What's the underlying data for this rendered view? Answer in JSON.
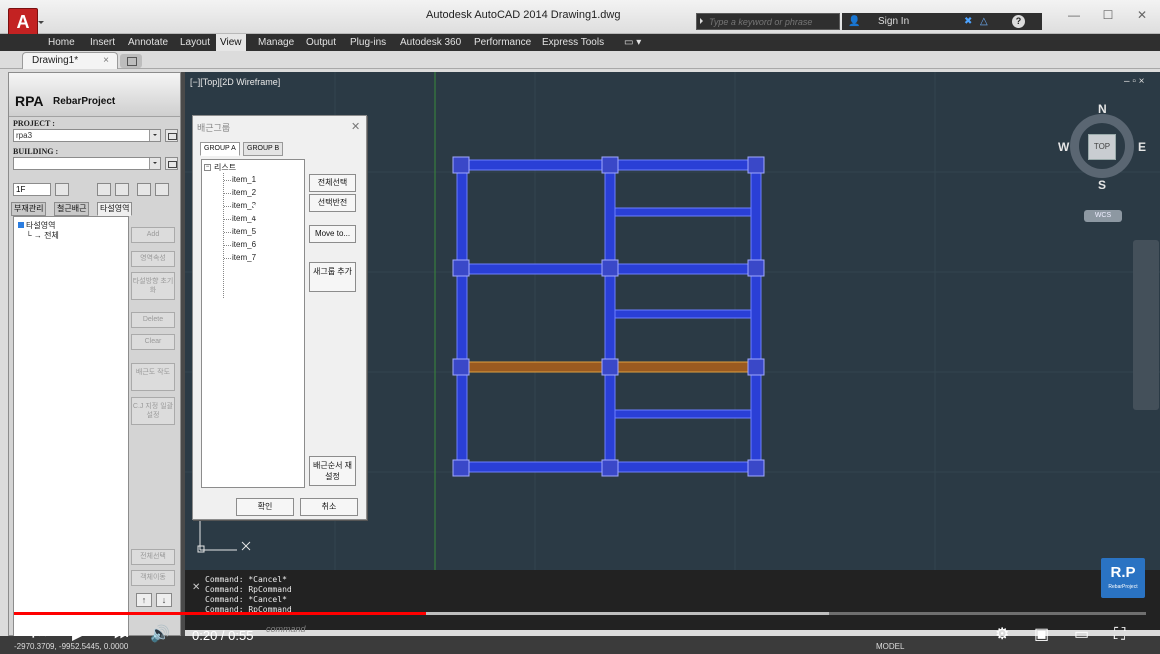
{
  "titlebar": {
    "title": "Autodesk AutoCAD 2014     Drawing1.dwg",
    "search_placeholder": "Type a keyword or phrase",
    "signin": "Sign In",
    "logo_letter": "A"
  },
  "ribbon_tabs": [
    "Home",
    "Insert",
    "Annotate",
    "Layout",
    "View",
    "Manage",
    "Output",
    "Plug-ins",
    "Autodesk 360",
    "Performance",
    "Express Tools"
  ],
  "active_ribbon_tab": "View",
  "doc_tab": "Drawing1*",
  "palette": {
    "brand": "RPA",
    "brand_sub": "RebarProject",
    "project_label": "PROJECT :",
    "project_value": "rpa3",
    "building_label": "BUILDING :",
    "building_value": "",
    "floor_value": "1F",
    "tabs": [
      "부재관리",
      "철근배근",
      "타설영역"
    ],
    "tree_root": "타설영역",
    "tree_child": "전체",
    "buttons": [
      "Add",
      "영역속성",
      "타설방향 초기화",
      "Delete",
      "Clear",
      "배근도 작도",
      "C.J 지정 일괄설정"
    ],
    "bottom_buttons": [
      "전체선택",
      "객체이동"
    ],
    "arrow_up": "↑",
    "arrow_down": "↓"
  },
  "viewport": {
    "label": "[−][Top][2D Wireframe]",
    "viewcube": {
      "top": "TOP",
      "n": "N",
      "s": "S",
      "e": "E",
      "w": "W",
      "wcs": "WCS"
    }
  },
  "dialog": {
    "title": "배근그룹",
    "tabs": [
      "GROUP A",
      "GROUP B"
    ],
    "list_root": "리스트",
    "items": [
      "item_1",
      "item_2",
      "item_3",
      "item_4",
      "item_5",
      "item_6",
      "item_7"
    ],
    "buttons": [
      "전체선택",
      "선택반전",
      "Move to...",
      "새그룹 추가",
      "배근순서 재설정"
    ],
    "ok": "확인",
    "cancel": "취소"
  },
  "command_history": [
    "Command: *Cancel*",
    "Command: RpCommand",
    "Command: *Cancel*",
    "Command: RpCommand"
  ],
  "command_prompt": "command",
  "rp_logo": {
    "big": "R.P",
    "small": "RebarProject"
  },
  "status": {
    "coords": "-2970.3709, -9952.5445, 0.0000",
    "model": "MODEL"
  },
  "video": {
    "current": "0:20",
    "duration": "0:55",
    "progress": 0.3636,
    "buffered": 0.72
  }
}
